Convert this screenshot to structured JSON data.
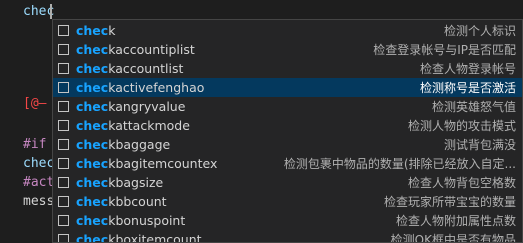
{
  "editor": {
    "typed_text": "chec",
    "lines": [
      {
        "text": "[@—",
        "color": "red"
      },
      {
        "text": "#if",
        "color": "purple"
      },
      {
        "text": "chec",
        "color": "blue"
      },
      {
        "text": "#act",
        "color": "purple"
      },
      {
        "text": "mess",
        "color": "plain"
      }
    ]
  },
  "suggestions": {
    "match_prefix": "chec",
    "items": [
      {
        "prefix": "chec",
        "rest": "k",
        "desc": "检测个人标识"
      },
      {
        "prefix": "chec",
        "rest": "kaccountiplist",
        "desc": "检查登录帐号与IP是否匹配"
      },
      {
        "prefix": "chec",
        "rest": "kaccountlist",
        "desc": "检查人物登录帐号"
      },
      {
        "prefix": "chec",
        "rest": "kactivefenghao",
        "desc": "检测称号是否激活",
        "selected": true
      },
      {
        "prefix": "chec",
        "rest": "kangryvalue",
        "desc": "检测英雄怒气值"
      },
      {
        "prefix": "chec",
        "rest": "kattackmode",
        "desc": "检测人物的攻击模式"
      },
      {
        "prefix": "chec",
        "rest": "kbaggage",
        "desc": "测试背包满没"
      },
      {
        "prefix": "chec",
        "rest": "kbagitemcountex",
        "desc": "检测包裹中物品的数量(排除已经放入自定..."
      },
      {
        "prefix": "chec",
        "rest": "kbagsize",
        "desc": "检查人物背包空格数"
      },
      {
        "prefix": "chec",
        "rest": "kbbcount",
        "desc": "检查玩家所带宝宝的数量"
      },
      {
        "prefix": "chec",
        "rest": "kbonuspoint",
        "desc": "检查人物附加属性点数"
      },
      {
        "prefix": "chec",
        "rest": "kboxitemcount",
        "desc": "检测OK框中是否有物品"
      }
    ]
  }
}
